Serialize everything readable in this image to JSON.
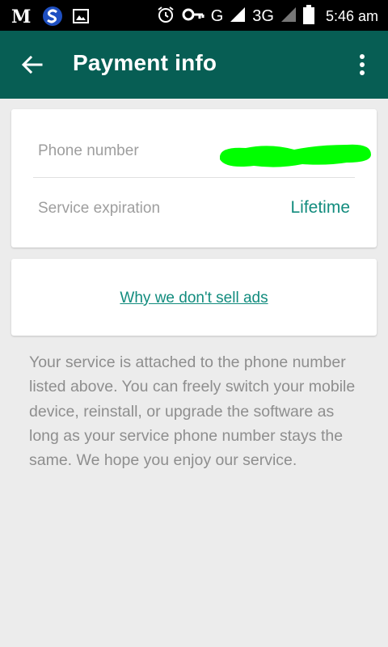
{
  "status_bar": {
    "icons": [
      "m-app-icon",
      "s-app-icon",
      "gallery-icon",
      "alarm-icon",
      "key-icon",
      "signal-g-icon",
      "signal-3g-icon",
      "battery-icon"
    ],
    "network_g": "G",
    "network_3g": "3G",
    "time": "5:46 am"
  },
  "app_bar": {
    "title": "Payment info",
    "color": "#075e54"
  },
  "info_card": {
    "phone_label": "Phone number",
    "expiration_label": "Service expiration",
    "expiration_value": "Lifetime"
  },
  "link_card": {
    "link_text": "Why we don't sell ads"
  },
  "description": "Your service is attached to the phone number listed above. You can freely switch your mobile device, reinstall, or upgrade the software as long as your service phone number stays the same. We hope you enjoy our service.",
  "colors": {
    "accent": "#128c7e",
    "redaction": "#00ff00",
    "background": "#ececec"
  }
}
